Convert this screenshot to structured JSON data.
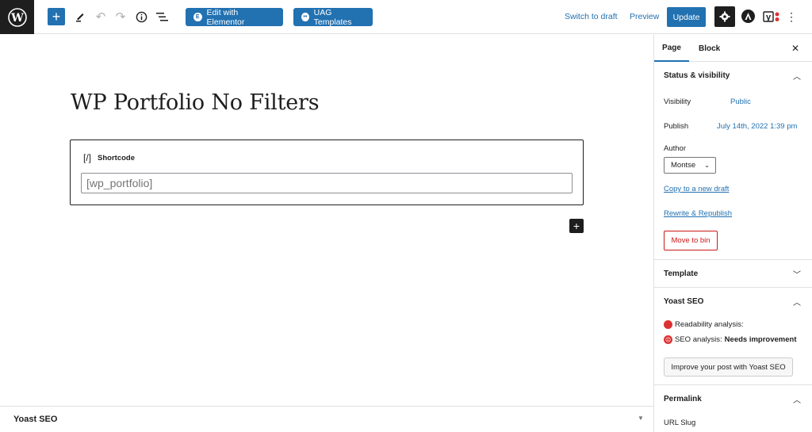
{
  "toolbar": {
    "edit_elementor": "Edit with Elementor",
    "uag_templates": "UAG Templates",
    "switch_to_draft": "Switch to draft",
    "preview": "Preview",
    "update": "Update",
    "elementor_icon": "E",
    "uag_icon": "••",
    "accent_color": "#2271b1"
  },
  "editor": {
    "post_title": "WP Portfolio No Filters",
    "block": {
      "icon": "[/]",
      "name": "Shortcode",
      "value": "[wp_portfolio]"
    }
  },
  "metabox": {
    "label": "Yoast SEO"
  },
  "sidebar": {
    "tabs": [
      {
        "label": "Page",
        "active": true
      },
      {
        "label": "Block",
        "active": false
      }
    ],
    "status_visibility": {
      "title": "Status & visibility",
      "visibility_label": "Visibility",
      "visibility_value": "Public",
      "publish_label": "Publish",
      "publish_value": "July 14th, 2022 1:39 pm",
      "author_label": "Author",
      "author_value": "Montse",
      "copy_draft": "Copy to a new draft",
      "rewrite": "Rewrite & Republish",
      "move_to_bin": "Move to bin"
    },
    "template": {
      "title": "Template"
    },
    "yoast": {
      "title": "Yoast SEO",
      "readability_label": "Readability analysis:",
      "seo_label": "SEO analysis:",
      "seo_value": "Needs improvement",
      "improve_button": "Improve your post with Yoast SEO",
      "status_color": "#dc3232"
    },
    "permalink": {
      "title": "Permalink",
      "url_slug_label": "URL Slug"
    }
  }
}
